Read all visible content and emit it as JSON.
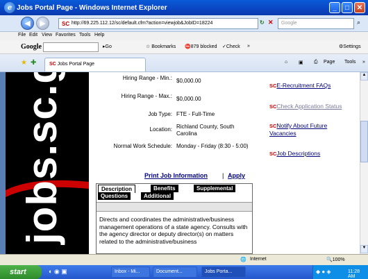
{
  "window": {
    "title": "Jobs Portal Page - Windows Internet Explorer"
  },
  "address": {
    "url": "http://69.225.112.12/sc/default.cfm?action=viewjob&JobID=18224",
    "search_placeholder": "Google"
  },
  "menu": [
    "File",
    "Edit",
    "View",
    "Favorites",
    "Tools",
    "Help"
  ],
  "google_toolbar": {
    "label": "Google",
    "go": "Go",
    "bookmarks": "Bookmarks",
    "blocked": "879 blocked",
    "check": "Check",
    "more": "»",
    "settings": "Settings"
  },
  "tab": {
    "label": "Jobs Portal Page"
  },
  "commands": {
    "page": "Page",
    "tools": "Tools",
    "more": "»"
  },
  "banner": {
    "text": "jobs.sc.g"
  },
  "job": {
    "rows": [
      {
        "label": "Hiring Range - Min.:",
        "value": "$0,000.00"
      },
      {
        "label": "Hiring Range - Max.:",
        "value": "$0,000.00"
      },
      {
        "label": "Job Type:",
        "value": "FTE - Full-Time"
      },
      {
        "label": "Location:",
        "value": "Richland County, South Carolina"
      },
      {
        "label": "Normal Work Schedule:",
        "value": "Monday - Friday (8:30 - 5:00)"
      }
    ],
    "print_label": "Print Job Information",
    "separator": "|",
    "apply_label": "Apply",
    "tabs": {
      "description": "Description",
      "benefits": "Benefits",
      "supplemental": "Supplemental",
      "questions": "Questions",
      "additional": "Additional"
    },
    "description_text": "Directs and coordinates the administrative/business management operations of a state agency. Consults with the agency director or deputy director(s) on matters related to the administrative/business"
  },
  "sidebar_links": [
    {
      "sc": "SC",
      "label": "E-Recruitment FAQs",
      "visited": false
    },
    {
      "sc": "SC",
      "label": "Check Application Status",
      "visited": true
    },
    {
      "sc": "SC",
      "label": "Notify About Future Vacancies",
      "visited": false
    },
    {
      "sc": "SC",
      "label": "Job Descriptions",
      "visited": false
    }
  ],
  "status": {
    "zone": "Internet",
    "zoom": "100%"
  },
  "taskbar": {
    "start": "start",
    "items": [
      "Inbox - Mi...",
      "Document...",
      "Jobs Porta..."
    ],
    "time": "11:28 AM"
  },
  "colors": {
    "title_bar": "#0a45c2",
    "sc_red": "#cc0000",
    "link_blue": "#000080",
    "visited": "#7a7a9a"
  }
}
